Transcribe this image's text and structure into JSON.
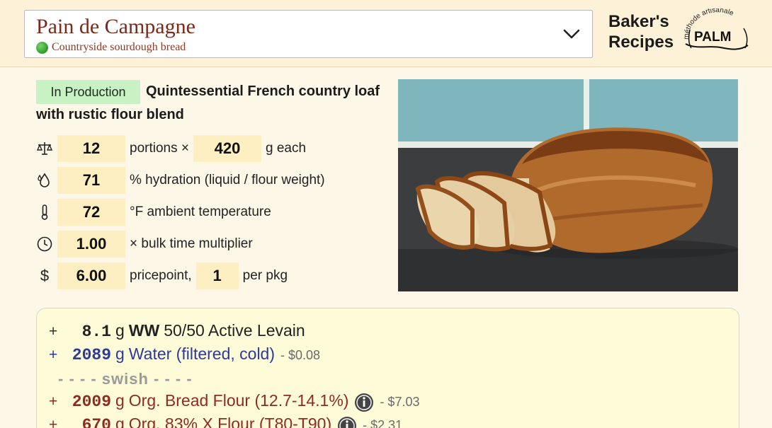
{
  "recipe": {
    "title": "Pain de Campagne",
    "subtitle": "Countryside sourdough bread"
  },
  "brand": {
    "line1": "Baker's",
    "line2": "Recipes",
    "logo_top": "méthode artisanale",
    "logo_main": "PALM"
  },
  "status": "In Production",
  "headline": "Quintessential French country loaf with rustic flour blend",
  "params": {
    "portions": {
      "value": "12",
      "label": "portions ×",
      "weight": "420",
      "weight_label": "g each"
    },
    "hydration": {
      "value": "71",
      "label": "% hydration (liquid / flour weight)"
    },
    "temperature": {
      "value": "72",
      "label": "°F ambient temperature"
    },
    "bulk": {
      "value": "1.00",
      "label": "× bulk time multiplier"
    },
    "price": {
      "value": "6.00",
      "label": "pricepoint,",
      "pkg": "1",
      "pkg_label": "per pkg"
    }
  },
  "ingredients": [
    {
      "plus": "+",
      "qty": "8.1",
      "unit": "g",
      "prefix": "WW",
      "name": "50/50 Active Levain",
      "color": "#222222",
      "price": ""
    },
    {
      "plus": "+",
      "qty": "2089",
      "unit": "g",
      "prefix": "",
      "name": "Water (filtered, cold)",
      "color": "#2d3a9c",
      "price": "- $0.08"
    },
    {
      "plus": "+",
      "qty": "2009",
      "unit": "g",
      "prefix": "",
      "name": "Org. Bread Flour (12.7-14.1%)",
      "color": "#8e2c22",
      "price": "- $7.03"
    },
    {
      "plus": "+",
      "qty": "670",
      "unit": "g",
      "prefix": "",
      "name": "Org. 83% X Flour (T80-T90)",
      "color": "#8e2c22",
      "price": "- $2.31"
    }
  ],
  "swish": "- - - - swish - - - -",
  "colors": {
    "accent": "#7a2a1a",
    "badge": "#c8f1c4",
    "input": "#fdefc2",
    "panel": "#fdfbd8"
  },
  "icons": [
    "chevron-down-icon",
    "scale-icon",
    "water-drop-icon",
    "thermometer-icon",
    "clock-icon",
    "dollar-icon",
    "info-icon"
  ]
}
